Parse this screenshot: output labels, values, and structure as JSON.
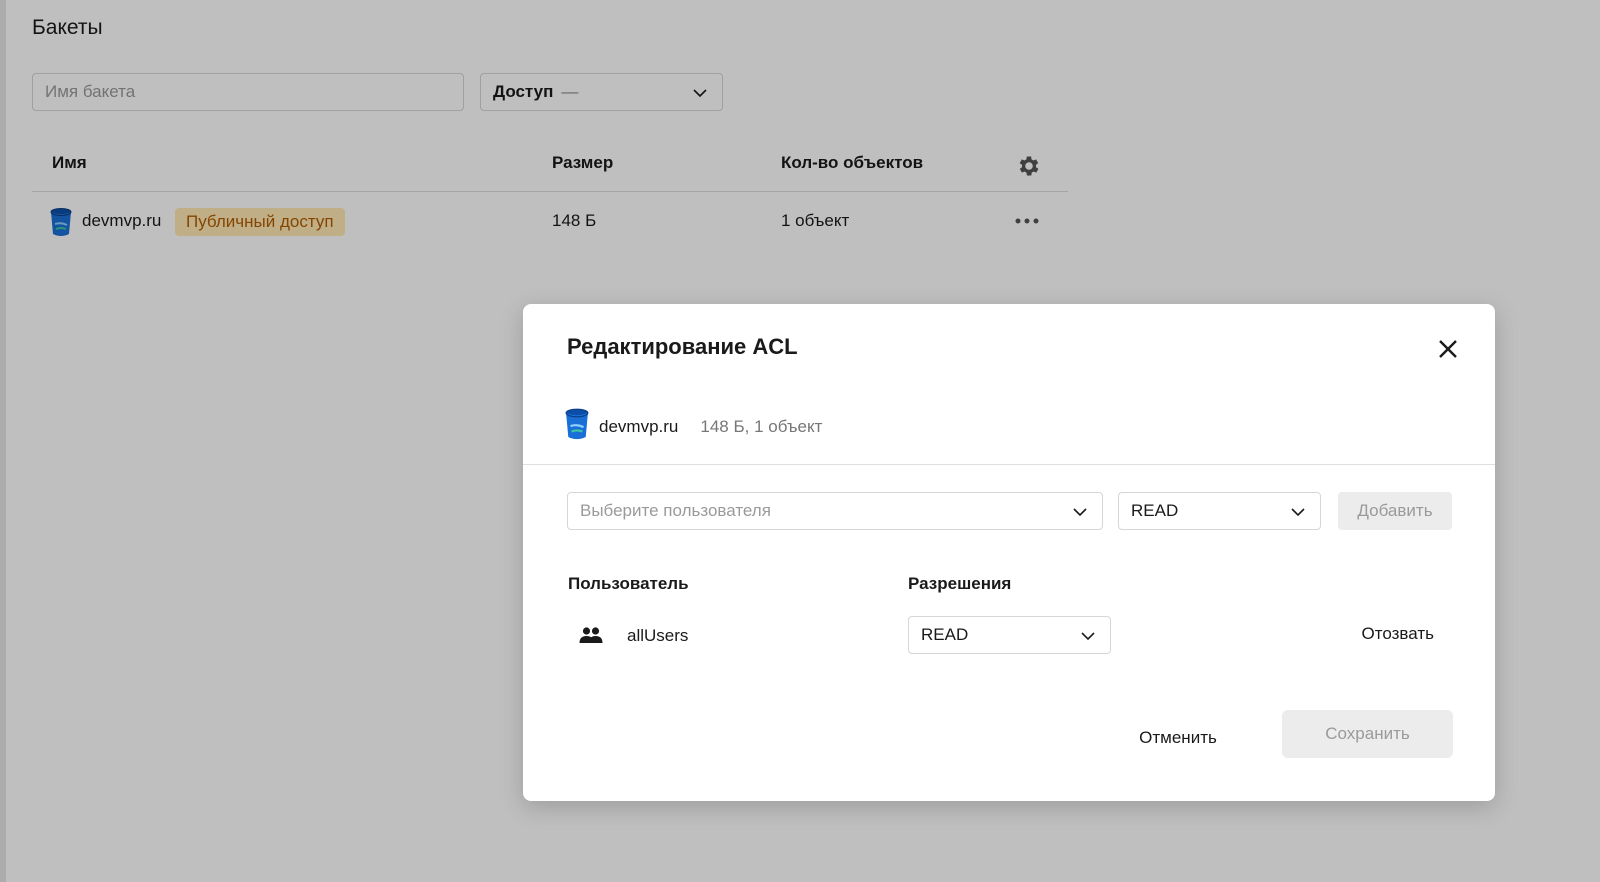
{
  "page": {
    "title": "Бакеты",
    "search": {
      "placeholder": "Имя бакета",
      "value": ""
    },
    "access_filter": {
      "label": "Доступ",
      "value": "—"
    },
    "table": {
      "columns": {
        "name": "Имя",
        "size": "Размер",
        "count": "Кол-во объектов"
      },
      "rows": [
        {
          "name": "devmvp.ru",
          "badge": "Публичный доступ",
          "size": "148 Б",
          "count": "1 объект"
        }
      ]
    }
  },
  "modal": {
    "title": "Редактирование ACL",
    "bucket": {
      "name": "devmvp.ru",
      "meta": "148 Б, 1 объект"
    },
    "user_select": {
      "placeholder": "Выберите пользователя"
    },
    "permission_select": {
      "value": "READ"
    },
    "add_label": "Добавить",
    "columns": {
      "user": "Пользователь",
      "permissions": "Разрешения"
    },
    "acl": [
      {
        "user": "allUsers",
        "permission": "READ",
        "revoke_label": "Отозвать"
      }
    ],
    "cancel_label": "Отменить",
    "save_label": "Сохранить"
  },
  "colors": {
    "badge_bg": "#ffe9b3",
    "badge_text": "#b35c00",
    "bucket_icon": "#1a6fd6",
    "overlay": "rgba(0,0,0,0.25)"
  },
  "icons": [
    "bucket-icon",
    "chevron-down-icon",
    "gear-icon",
    "more-icon",
    "close-icon",
    "users-icon"
  ]
}
